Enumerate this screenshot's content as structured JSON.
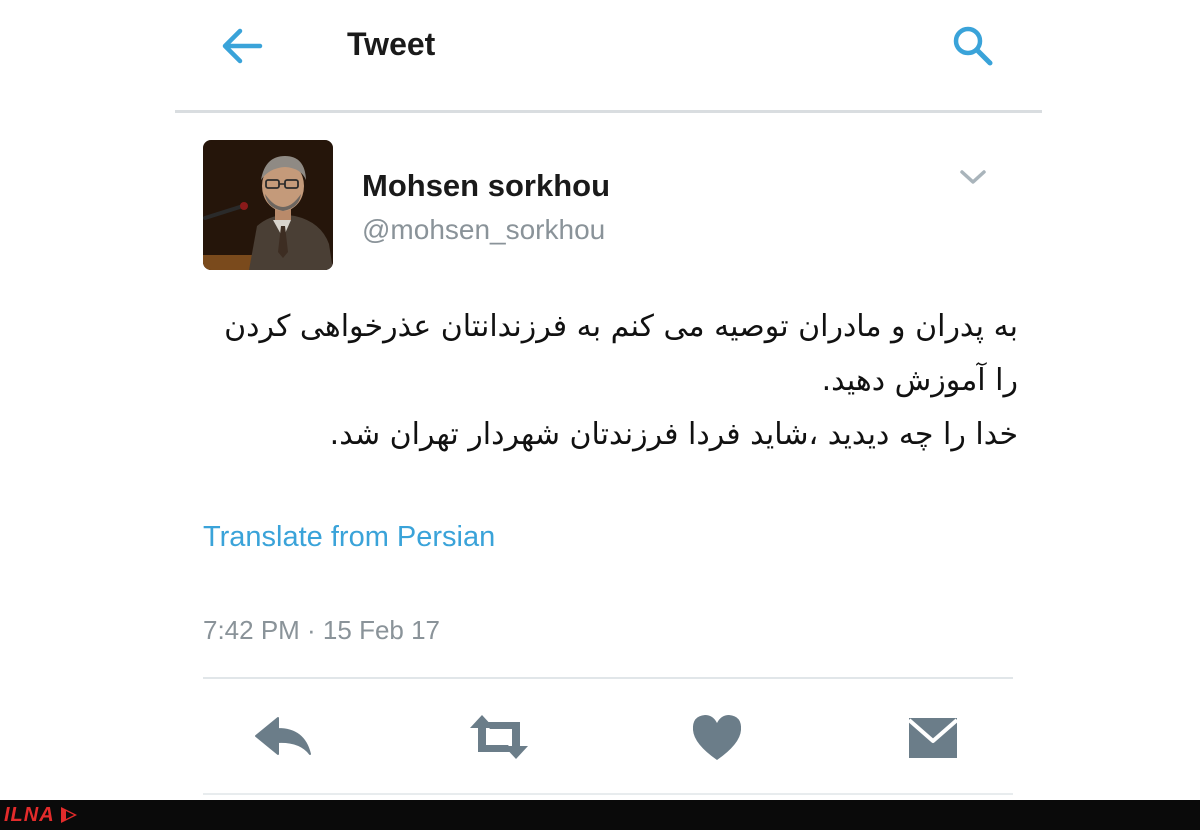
{
  "header": {
    "title": "Tweet",
    "back_icon": "arrow-left-icon",
    "search_icon": "search-icon"
  },
  "tweet": {
    "display_name": "Mohsen sorkhou",
    "handle": "@mohsen_sorkhou",
    "avatar_icon": "profile-photo",
    "menu_icon": "chevron-down-icon",
    "text": "به پدران و مادران توصیه می کنم به فرزندانتان عذرخواهی کردن را آموزش دهید.\nخدا را چه دیدید ،شاید فردا فرزندتان شهردار تهران شد.",
    "translate_label": "Translate from Persian",
    "timestamp": "7:42 PM · 15 Feb 17"
  },
  "actions": [
    {
      "name": "reply",
      "icon": "reply-icon"
    },
    {
      "name": "retweet",
      "icon": "retweet-icon"
    },
    {
      "name": "like",
      "icon": "heart-icon"
    },
    {
      "name": "message",
      "icon": "envelope-icon"
    }
  ],
  "watermark": {
    "text": "ILNA"
  },
  "colors": {
    "accent": "#3aa3d9",
    "icon_gray": "#6b7d89",
    "text": "#1a1a1a",
    "secondary_text": "#8a9399",
    "watermark_red": "#e32b2b"
  }
}
